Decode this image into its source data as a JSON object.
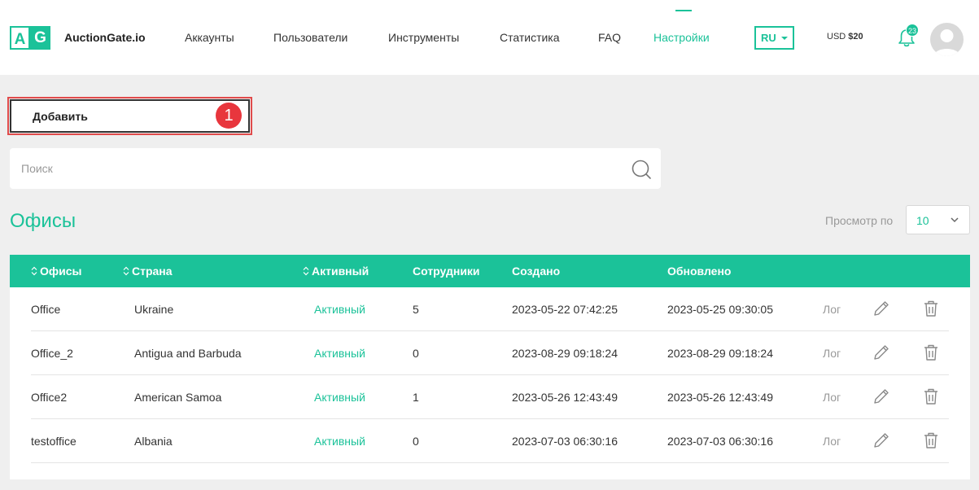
{
  "header": {
    "logo_letters": [
      "A",
      "G"
    ],
    "brand": "AuctionGate.io",
    "nav": [
      {
        "label": "Аккаунты",
        "active": false
      },
      {
        "label": "Пользователи",
        "active": false
      },
      {
        "label": "Инструменты",
        "active": false
      },
      {
        "label": "Статистика",
        "active": false
      },
      {
        "label": "FAQ",
        "active": false
      },
      {
        "label": "Настройки",
        "active": true
      }
    ],
    "language": "RU",
    "balance_currency": "USD",
    "balance_amount": "$20",
    "notifications_count": "23"
  },
  "toolbar": {
    "add_label": "Добавить",
    "step_marker": "1"
  },
  "search": {
    "placeholder": "Поиск",
    "value": ""
  },
  "page": {
    "title": "Офисы",
    "per_page_label": "Просмотр по",
    "per_page_value": "10"
  },
  "table": {
    "columns": [
      "Офисы",
      "Страна",
      "Активный",
      "Сотрудники",
      "Создано",
      "Обновлено"
    ],
    "rows": [
      {
        "office": "Office",
        "country": "Ukraine",
        "status": "Активный",
        "employees": "5",
        "created": "2023-05-22 07:42:25",
        "updated": "2023-05-25 09:30:05",
        "log": "Лог"
      },
      {
        "office": "Office_2",
        "country": "Antigua and Barbuda",
        "status": "Активный",
        "employees": "0",
        "created": "2023-08-29 09:18:24",
        "updated": "2023-08-29 09:18:24",
        "log": "Лог"
      },
      {
        "office": "Office2",
        "country": "American Samoa",
        "status": "Активный",
        "employees": "1",
        "created": "2023-05-26 12:43:49",
        "updated": "2023-05-26 12:43:49",
        "log": "Лог"
      },
      {
        "office": "testoffice",
        "country": "Albania",
        "status": "Активный",
        "employees": "0",
        "created": "2023-07-03 06:30:16",
        "updated": "2023-07-03 06:30:16",
        "log": "Лог"
      }
    ]
  },
  "colors": {
    "accent": "#1bc299",
    "marker": "#e8363d",
    "highlight_outline": "#e04b4b"
  },
  "icons": {
    "search": "search-icon",
    "notifications": "bell-icon",
    "avatar": "user-avatar-icon",
    "edit": "pencil-icon",
    "delete": "trash-icon",
    "sort": "sort-arrows-icon",
    "dropdown": "chevron-down-icon"
  }
}
